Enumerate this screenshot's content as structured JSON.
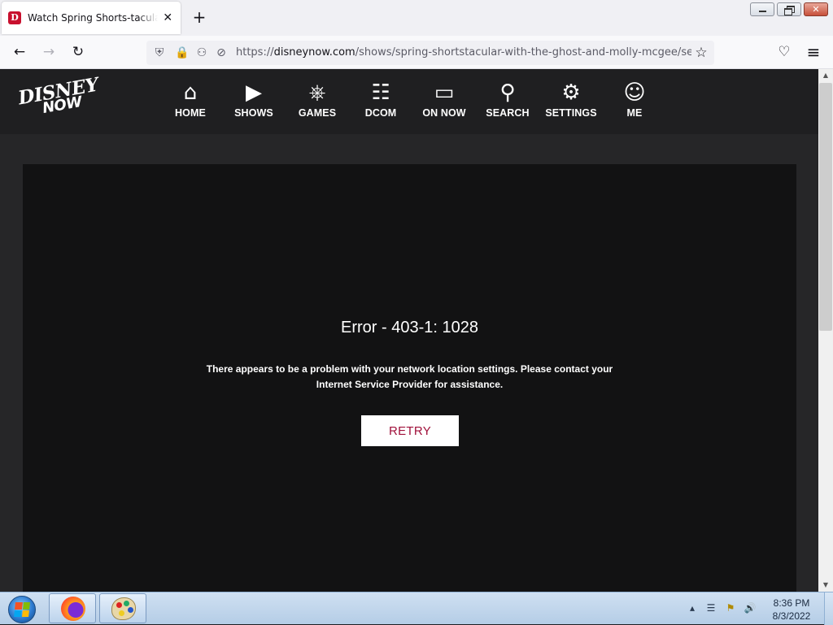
{
  "browser": {
    "tab": {
      "favicon": "D",
      "title": "Watch Spring Shorts-tacular with",
      "close": "✕"
    },
    "new_tab": "+",
    "window_buttons": [
      "minimize",
      "maximize",
      "close"
    ],
    "url": {
      "scheme": "https://",
      "host": "disneynow.com",
      "path": "/shows/spring-shortstacular-with-the-ghost-and-molly-mcgee/seasc"
    },
    "icons": {
      "back": "←",
      "forward": "→",
      "reload": "↻",
      "shield": "⛨",
      "lock": "🔒",
      "permissions": "⚇",
      "tracking": "⊘",
      "bookmark": "☆",
      "pocket": "♡",
      "menu": "≡"
    }
  },
  "site": {
    "logo": {
      "top": "DISNEY",
      "bottom": "NOW"
    },
    "nav": [
      {
        "label": "HOME",
        "icon": "⌂"
      },
      {
        "label": "SHOWS",
        "icon": "▶"
      },
      {
        "label": "GAMES",
        "icon": "⎈"
      },
      {
        "label": "DCOM",
        "icon": "☷"
      },
      {
        "label": "ON NOW",
        "icon": "▭"
      },
      {
        "label": "SEARCH",
        "icon": "⚲"
      },
      {
        "label": "SETTINGS",
        "icon": "⚙"
      },
      {
        "label": "ME",
        "icon": "☺"
      }
    ],
    "error": {
      "title": "Error - 403-1: 1028",
      "message": "There appears to be a problem with your network location settings. Please contact your Internet Service Provider for assistance.",
      "retry": "RETRY"
    }
  },
  "taskbar": {
    "tray_icons": {
      "arrow": "▴",
      "network": "☰",
      "flag": "⚑",
      "volume": "🔊"
    },
    "time": "8:36 PM",
    "date": "8/3/2022"
  },
  "colors": {
    "retry_text": "#a0103a",
    "player_bg": "#121213",
    "header_bg": "#1f1f21"
  }
}
